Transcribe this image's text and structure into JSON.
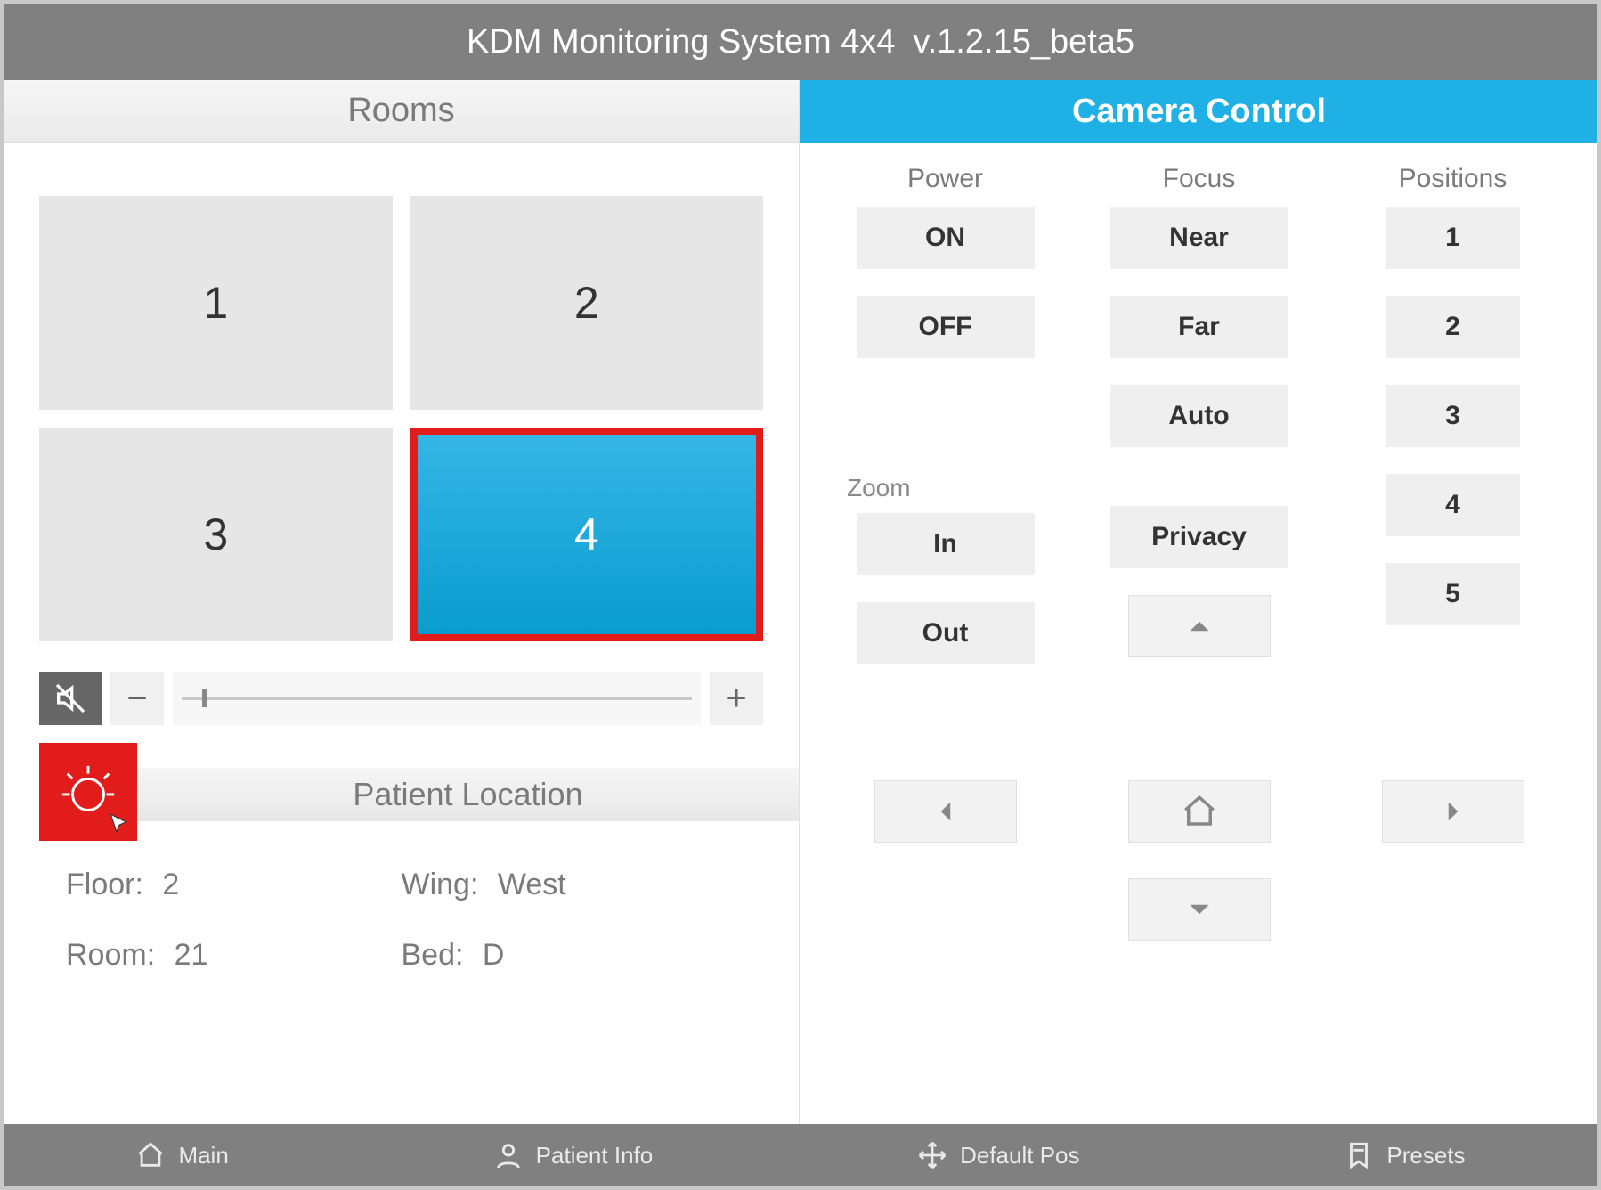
{
  "title": {
    "app": "KDM Monitoring System 4x4",
    "version": "v.1.2.15_beta5"
  },
  "left": {
    "header": "Rooms",
    "rooms": [
      "1",
      "2",
      "3",
      "4"
    ],
    "selected_room_index": 3,
    "patient_location": {
      "header": "Patient Location",
      "floor_label": "Floor:",
      "floor_value": "2",
      "wing_label": "Wing:",
      "wing_value": "West",
      "room_label": "Room:",
      "room_value": "21",
      "bed_label": "Bed:",
      "bed_value": "D"
    }
  },
  "right": {
    "header": "Camera Control",
    "columns": {
      "power": {
        "title": "Power",
        "on": "ON",
        "off": "OFF"
      },
      "focus": {
        "title": "Focus",
        "near": "Near",
        "far": "Far",
        "auto": "Auto",
        "privacy": "Privacy"
      },
      "positions": {
        "title": "Positions",
        "items": [
          "1",
          "2",
          "3",
          "4",
          "5"
        ]
      }
    },
    "zoom": {
      "label": "Zoom",
      "in": "In",
      "out": "Out"
    }
  },
  "bottom": {
    "main": "Main",
    "patient_info": "Patient Info",
    "default_pos": "Default Pos",
    "presets": "Presets"
  },
  "colors": {
    "accent": "#1fb1e6",
    "alert": "#e21b1b",
    "gray_header": "#808080"
  }
}
